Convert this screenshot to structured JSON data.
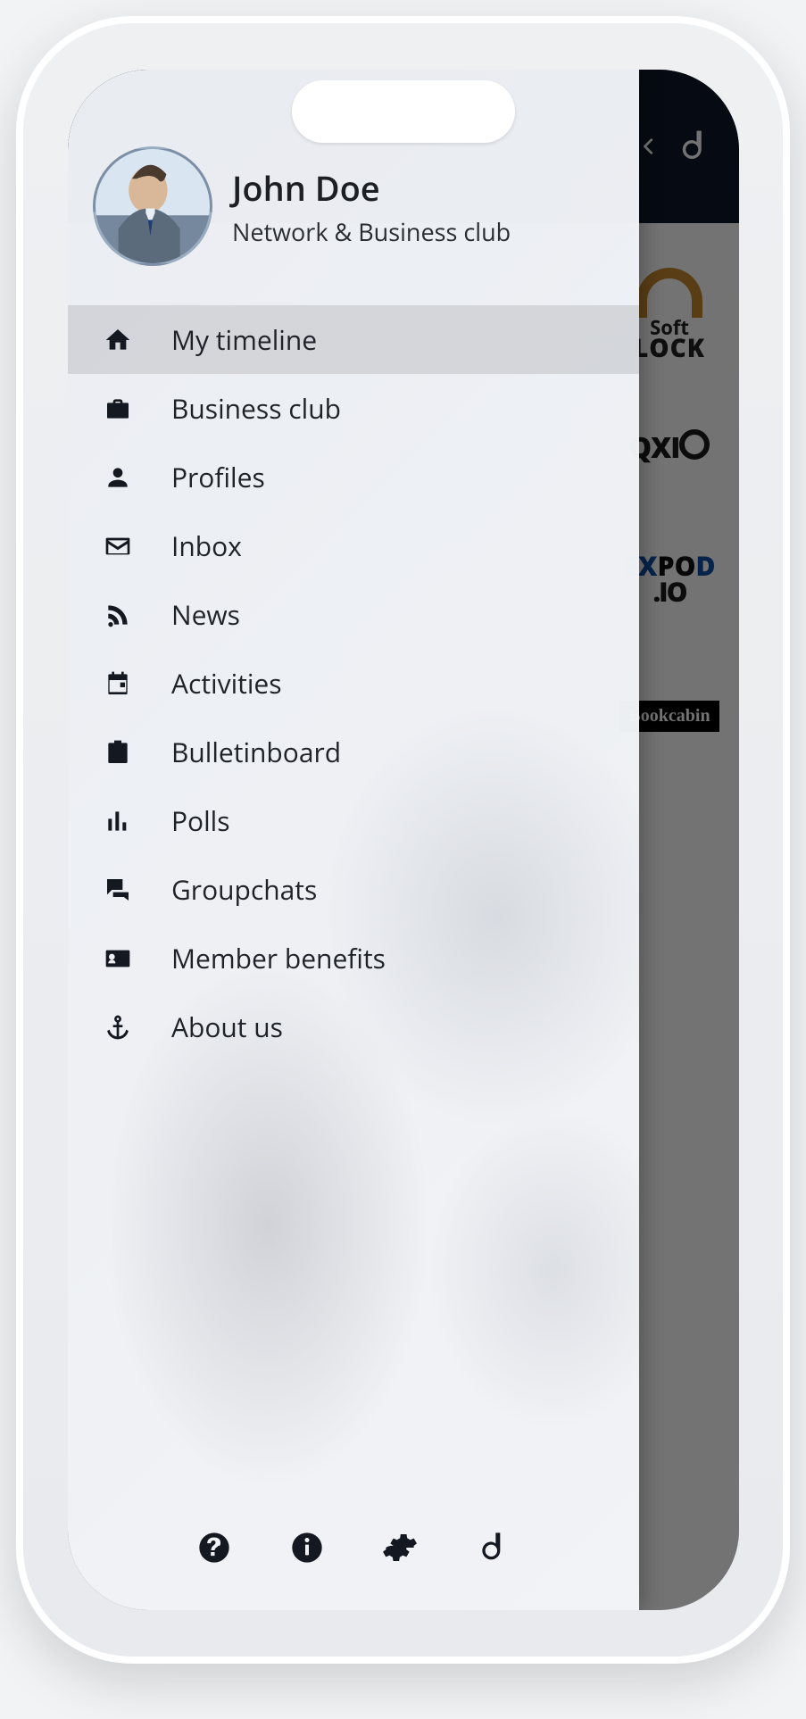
{
  "profile": {
    "name": "John Doe",
    "subtitle": "Network & Business club"
  },
  "nav": {
    "items": [
      {
        "key": "timeline",
        "label": "My timeline",
        "icon": "home-icon",
        "active": true
      },
      {
        "key": "businessclub",
        "label": "Business club",
        "icon": "briefcase-icon",
        "active": false
      },
      {
        "key": "profiles",
        "label": "Profiles",
        "icon": "person-icon",
        "active": false
      },
      {
        "key": "inbox",
        "label": "Inbox",
        "icon": "mail-icon",
        "active": false
      },
      {
        "key": "news",
        "label": "News",
        "icon": "rss-icon",
        "active": false
      },
      {
        "key": "activities",
        "label": "Activities",
        "icon": "calendar-icon",
        "active": false
      },
      {
        "key": "bulletin",
        "label": "Bulletinboard",
        "icon": "board-icon",
        "active": false
      },
      {
        "key": "polls",
        "label": "Polls",
        "icon": "bars-icon",
        "active": false
      },
      {
        "key": "groupchats",
        "label": "Groupchats",
        "icon": "chat-icon",
        "active": false
      },
      {
        "key": "benefits",
        "label": "Member benefits",
        "icon": "id-card-icon",
        "active": false
      },
      {
        "key": "about",
        "label": "About us",
        "icon": "anchor-icon",
        "active": false
      }
    ]
  },
  "bottom_actions": [
    {
      "key": "help",
      "icon": "help-icon"
    },
    {
      "key": "info",
      "icon": "info-icon"
    },
    {
      "key": "settings",
      "icon": "gear-icon"
    },
    {
      "key": "brand",
      "icon": "brand-b-icon"
    }
  ],
  "background_header": {
    "back_icon": "chevron-left-icon",
    "brand_icon": "brand-b-icon"
  },
  "background_logos": {
    "logo1_line1": "Soft",
    "logo1_line2": "LOCK",
    "logo2": "QXI",
    "logo3a": "EX",
    "logo3b": "PO",
    "logo3c": "D",
    "logo3_io": ".IO",
    "logo4": "Bookcabin"
  }
}
